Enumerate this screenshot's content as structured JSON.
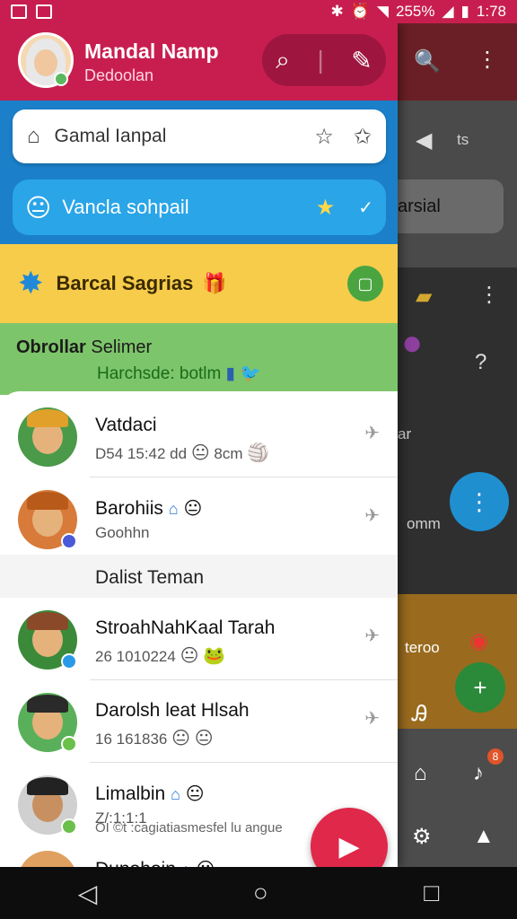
{
  "status_bar": {
    "battery": "255%",
    "time": "1:78"
  },
  "header": {
    "user_name": "Mandal Namp",
    "user_sub": "Dedoolan"
  },
  "search_bar": {
    "text": "Gamal Ianpal"
  },
  "featured": {
    "text": "Vancla sohpail"
  },
  "banner": {
    "title": "Barcal Sagrias"
  },
  "section_chats": {
    "title_a": "Obrollar",
    "title_b": "Selimer",
    "subtitle": "Harchsde: botlm"
  },
  "chats": [
    {
      "name": "Vatdaci",
      "meta": "D54 15:42 dd",
      "meta2": "8cm"
    },
    {
      "name": "Barohiis",
      "meta": "Goohhn"
    }
  ],
  "section_friends": {
    "title": "Dalist Teman"
  },
  "friends": [
    {
      "name": "StroahNahKaal Tarah",
      "meta": "26 1010224"
    },
    {
      "name": "Darolsh leat Hlsah",
      "meta": "16 161836"
    },
    {
      "name": "Limalbin",
      "meta": "Z/:1:1:1"
    },
    {
      "name": "Dunohoin",
      "meta": ""
    }
  ],
  "preview_text": "OI ©t :cagiatiasmesfel lu angue",
  "background": {
    "pill": "arsial",
    "label_ts": "ts",
    "label_ar": "ar",
    "label_omm": "omm",
    "label_teroo": "teroo",
    "badge_count": "8"
  }
}
